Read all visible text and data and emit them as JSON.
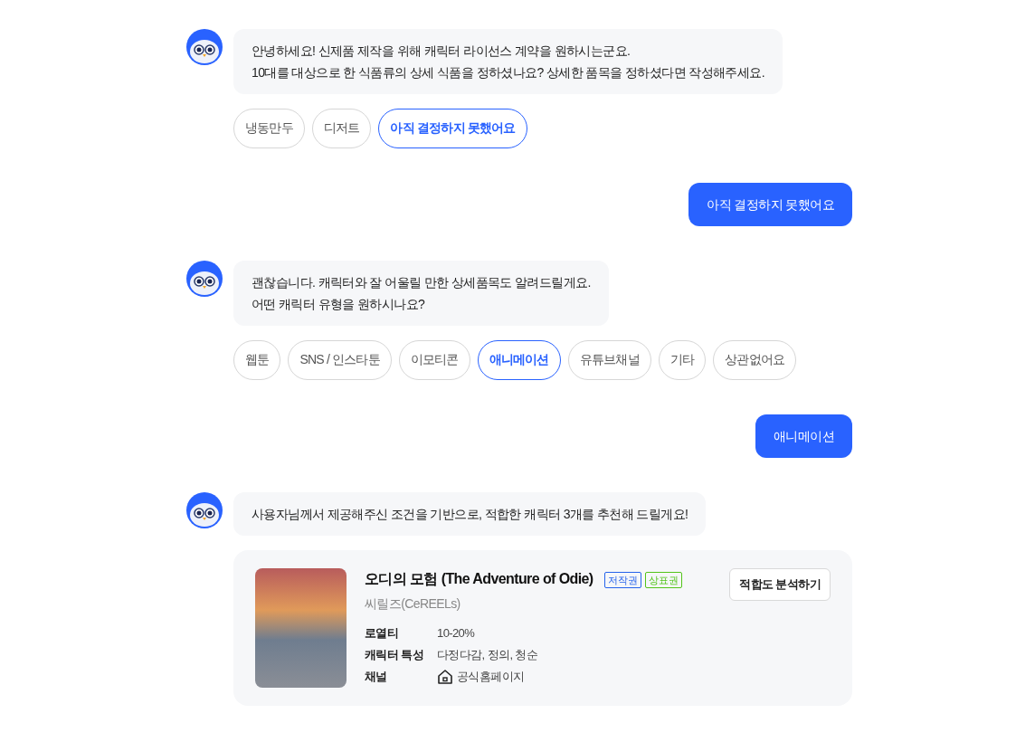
{
  "messages": [
    {
      "kind": "bot",
      "lines": [
        "안녕하세요! 신제품 제작을 위해 캐릭터 라이선스 계약을 원하시는군요.",
        "10대를 대상으로 한 식품류의 상세 식품을 정하셨나요? 상세한 품목을 정하셨다면 작성해주세요."
      ],
      "chips": [
        {
          "label": "냉동만두",
          "selected": false
        },
        {
          "label": "디저트",
          "selected": false
        },
        {
          "label": "아직 결정하지 못했어요",
          "selected": true
        }
      ]
    },
    {
      "kind": "user",
      "text": "아직 결정하지 못했어요"
    },
    {
      "kind": "bot",
      "lines": [
        "괜찮습니다. 캐릭터와 잘 어울릴 만한 상세품목도 알려드릴게요.",
        "어떤 캐릭터 유형을 원하시나요?"
      ],
      "chips": [
        {
          "label": "웹툰",
          "selected": false
        },
        {
          "label": "SNS / 인스타툰",
          "selected": false
        },
        {
          "label": "이모티콘",
          "selected": false
        },
        {
          "label": "애니메이션",
          "selected": true
        },
        {
          "label": "유튜브채널",
          "selected": false
        },
        {
          "label": "기타",
          "selected": false
        },
        {
          "label": "상관없어요",
          "selected": false
        }
      ]
    },
    {
      "kind": "user",
      "text": "애니메이션"
    },
    {
      "kind": "bot",
      "lines": [
        "사용자님께서 제공해주신 조건을 기반으로, 적합한 캐릭터 3개를 추천해 드릴게요!"
      ],
      "cards": [
        {
          "title": "오디의 모험 (The Adventure of Odie)",
          "badges": [
            {
              "label": "저작권",
              "color": "#2563eb"
            },
            {
              "label": "상표권",
              "color": "#52c41a"
            }
          ],
          "creator": "씨릴즈(CeREELs)",
          "action": "적합도 분석하기",
          "details": [
            {
              "kind": "text",
              "label": "로열티",
              "value": "10-20%"
            },
            {
              "kind": "text",
              "label": "캐릭터 특성",
              "value": "다정다감, 정의, 청순"
            },
            {
              "kind": "home",
              "label": "채널",
              "value": "공식홈페이지"
            }
          ]
        }
      ]
    }
  ]
}
